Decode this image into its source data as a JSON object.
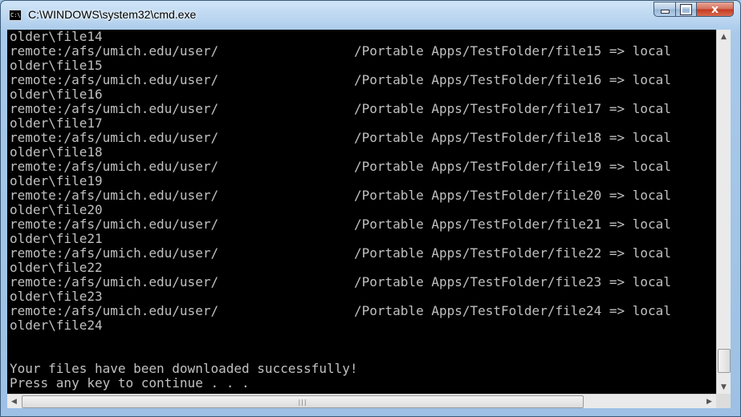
{
  "window": {
    "title": "C:\\WINDOWS\\system32\\cmd.exe",
    "icon": "cmd-icon",
    "icon_text": "C:\\"
  },
  "controls": {
    "minimize": "minimize-icon",
    "maximize": "maximize-icon",
    "close": "close-icon",
    "close_glyph": "x"
  },
  "console": {
    "first_line": "older\\file14",
    "entries": [
      {
        "left": "remote:/afs/umich.edu/user/",
        "right": "/Portable Apps/TestFolder/file15 => local",
        "wrap": "older\\file15"
      },
      {
        "left": "remote:/afs/umich.edu/user/",
        "right": "/Portable Apps/TestFolder/file16 => local",
        "wrap": "older\\file16"
      },
      {
        "left": "remote:/afs/umich.edu/user/",
        "right": "/Portable Apps/TestFolder/file17 => local",
        "wrap": "older\\file17"
      },
      {
        "left": "remote:/afs/umich.edu/user/",
        "right": "/Portable Apps/TestFolder/file18 => local",
        "wrap": "older\\file18"
      },
      {
        "left": "remote:/afs/umich.edu/user/",
        "right": "/Portable Apps/TestFolder/file19 => local",
        "wrap": "older\\file19"
      },
      {
        "left": "remote:/afs/umich.edu/user/",
        "right": "/Portable Apps/TestFolder/file20 => local",
        "wrap": "older\\file20"
      },
      {
        "left": "remote:/afs/umich.edu/user/",
        "right": "/Portable Apps/TestFolder/file21 => local",
        "wrap": "older\\file21"
      },
      {
        "left": "remote:/afs/umich.edu/user/",
        "right": "/Portable Apps/TestFolder/file22 => local",
        "wrap": "older\\file22"
      },
      {
        "left": "remote:/afs/umich.edu/user/",
        "right": "/Portable Apps/TestFolder/file23 => local",
        "wrap": "older\\file23"
      },
      {
        "left": "remote:/afs/umich.edu/user/",
        "right": "/Portable Apps/TestFolder/file24 => local",
        "wrap": "older\\file24"
      }
    ],
    "success_message": "Your files have been downloaded successfully!",
    "prompt_message": "Press any key to continue . . ."
  },
  "scrollbars": {
    "vertical": {
      "up": "scroll-up-arrow-icon",
      "down": "scroll-down-arrow-icon",
      "position": 0.93
    },
    "horizontal": {
      "left": "scroll-left-arrow-icon",
      "right": "scroll-right-arrow-icon",
      "grip": "|||"
    }
  },
  "colors": {
    "console_bg": "#000000",
    "console_text": "#c0c0c0",
    "frame": "#9dc0e4",
    "close_button": "#c43a1f"
  }
}
